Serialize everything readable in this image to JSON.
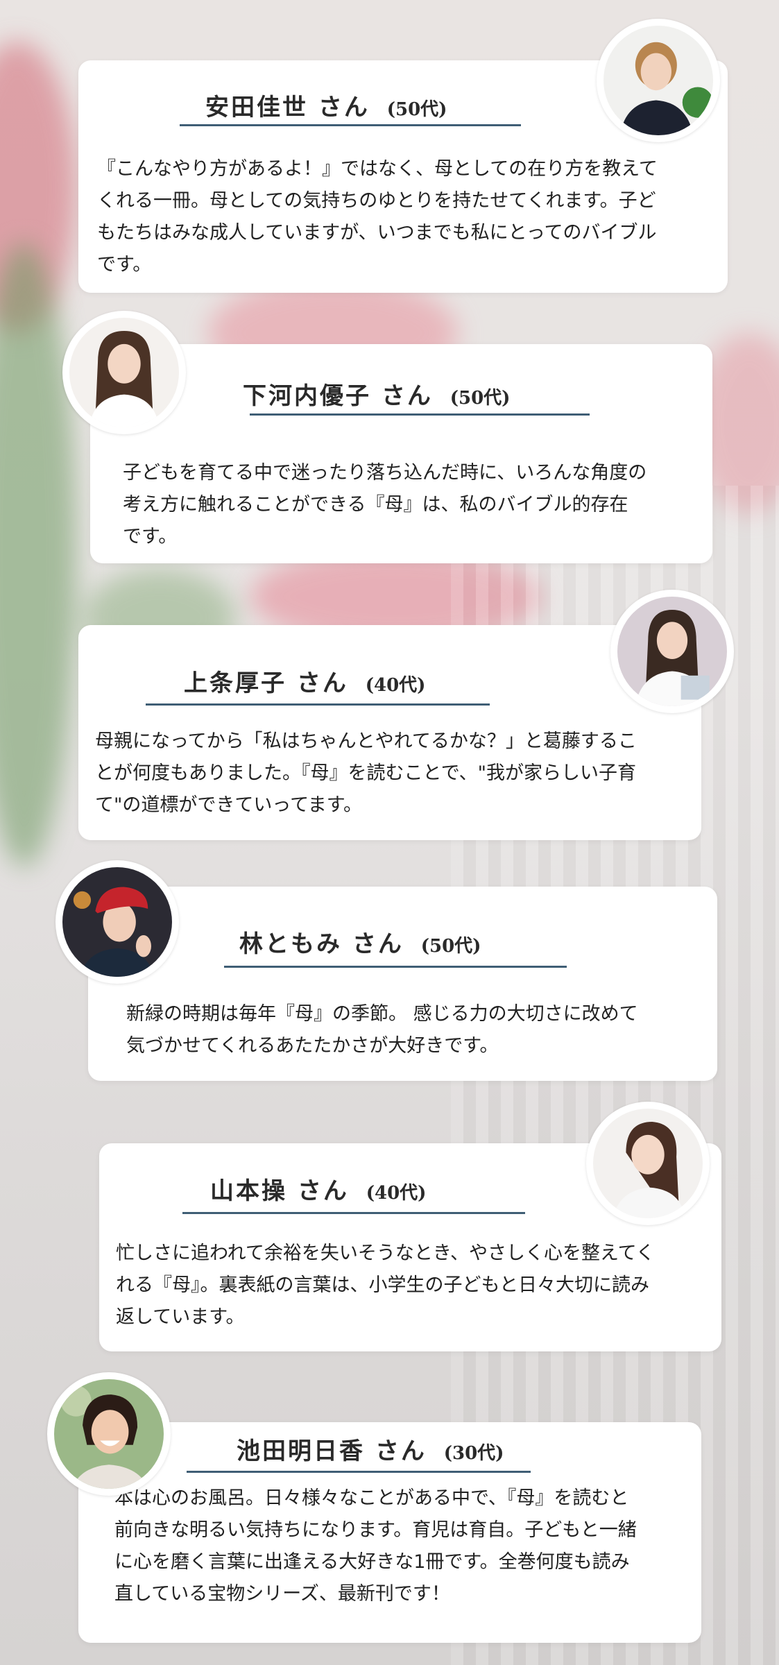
{
  "testimonials": [
    {
      "name": "安田佳世",
      "suffix": "さん",
      "age": "(50代)",
      "text": "『こんなやり方があるよ！』ではなく、母としての在り方を教えて\nくれる一冊。母としての気持ちのゆとりを持たせてくれます。子ど\nもたちはみな成人していますが、いつまでも私にとってのバイブル\nです。",
      "photo": "woman-short-hair-black-top-avatar"
    },
    {
      "name": "下河内優子",
      "suffix": "さん",
      "age": "(50代)",
      "text": "子どもを育てる中で迷ったり落ち込んだ時に、いろんな角度の\n考え方に触れることができる『母』は、私のバイブル的存在\nです。",
      "photo": "woman-long-hair-smiling-avatar"
    },
    {
      "name": "上条厚子",
      "suffix": "さん",
      "age": "(40代)",
      "text": "母親になってから「私はちゃんとやれてるかな？」と葛藤するこ\nとが何度もありました。『母』を読むことで、\"我が家らしい子育\nて\"の道標ができていってます。",
      "photo": "woman-long-hair-holding-book-avatar"
    },
    {
      "name": "林ともみ",
      "suffix": "さん",
      "age": "(50代)",
      "text": "新緑の時期は毎年『母』の季節。 感じる力の大切さに改めて\n気づかせてくれるあたたかさが大好きです。",
      "photo": "woman-red-beret-waving-avatar"
    },
    {
      "name": "山本操",
      "suffix": "さん",
      "age": "(40代)",
      "text": "忙しさに追われて余裕を失いそうなとき、やさしく心を整えてく\nれる『母』。裏表紙の言葉は、小学生の子どもと日々大切に読み\n返しています。",
      "photo": "woman-smiling-white-top-avatar"
    },
    {
      "name": "池田明日香",
      "suffix": "さん",
      "age": "(30代)",
      "text": "本は心のお風呂。日々様々なことがある中で、『母』を読むと\n前向きな明るい気持ちになります。育児は育自。子どもと一緒\nに心を磨く言葉に出逢える大好きな1冊です。全巻何度も読み\n直している宝物シリーズ、最新刊です！",
      "photo": "woman-laughing-outdoors-avatar"
    }
  ],
  "colors": {
    "underline": "#3f5e75",
    "card": "#ffffff",
    "accent_pink": "#e8a5ad",
    "leaf_green": "#6f9a62"
  }
}
